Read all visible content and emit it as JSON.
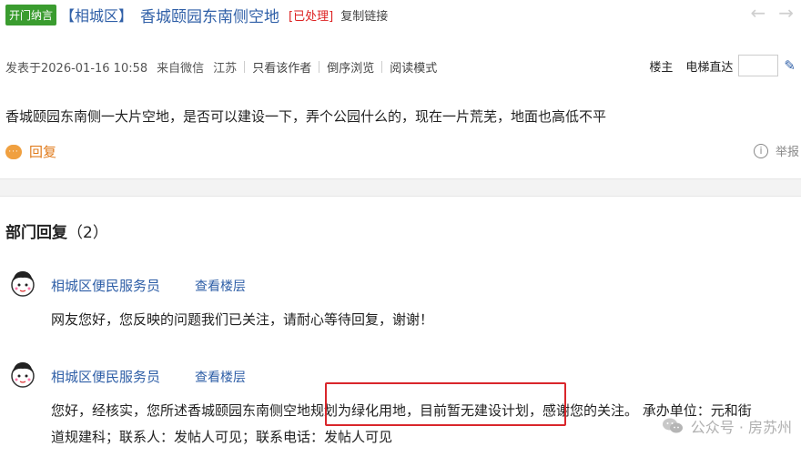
{
  "post": {
    "tag": "开门纳言",
    "district": "【相城区】",
    "title": "香城颐园东南侧空地",
    "status": "[已处理]",
    "copy_link": "复制链接",
    "meta": {
      "published": "发表于2026-01-16 10:58",
      "source": "来自微信",
      "location": "江苏",
      "only_author": "只看该作者",
      "reverse_browse": "倒序浏览",
      "reading_mode": "阅读模式"
    },
    "actions": {
      "louzhu": "楼主",
      "elevator": "电梯直达"
    },
    "content": "香城颐园东南侧一大片空地，是否可以建设一下，弄个公园什么的，现在一片荒芜，地面也高低不平",
    "reply_label": "回复",
    "report_label": "举报"
  },
  "dept_replies": {
    "title": "部门回复",
    "count": "（2）",
    "items": [
      {
        "user": "相城区便民服务员",
        "floor_link": "查看楼层",
        "text": "网友您好，您反映的问题我们已关注，请耐心等待回复，谢谢！"
      },
      {
        "user": "相城区便民服务员",
        "floor_link": "查看楼层",
        "text_line1": "您好，经核实，您所述香城颐园东南侧空地规划为绿化用地，目前暂无建设计划，感谢您的关注。 承办单位：元和街",
        "text_line2": "道规建科；联系人：发帖人可见；联系电话：发帖人可见"
      }
    ]
  },
  "watermark": "公众号 · 房苏州",
  "colors": {
    "link_blue": "#2f5fa7",
    "status_red": "#d22",
    "tag_green": "#3a9c2f",
    "reply_orange": "#e07a1a",
    "highlight_red": "#d9262b"
  },
  "icons": [
    "back-arrow-icon",
    "forward-arrow-icon",
    "edit-pen-icon",
    "chat-bubble-icon",
    "info-icon",
    "avatar-icon",
    "wechat-icon"
  ]
}
